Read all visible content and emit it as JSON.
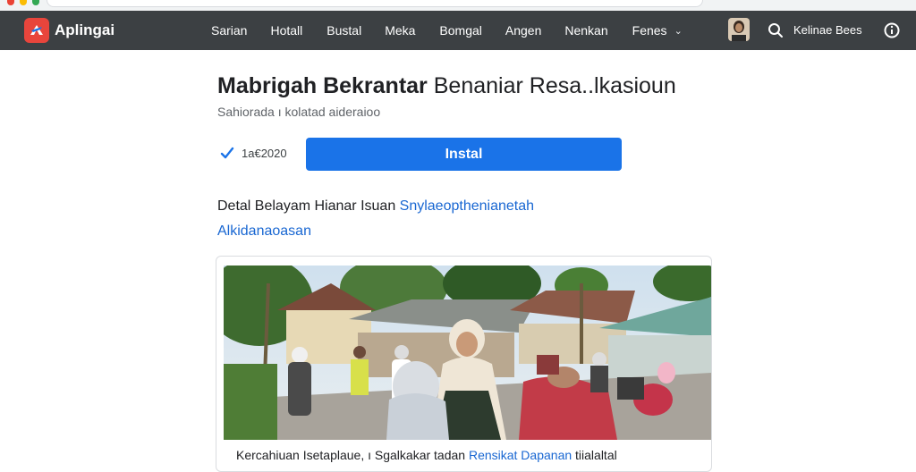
{
  "app": {
    "brand": "Aplingai"
  },
  "nav": {
    "items": [
      "Sarian",
      "Hotall",
      "Bustal",
      "Meka",
      "Bomgal",
      "Angen",
      "Nenkan",
      "Fenes"
    ]
  },
  "user": {
    "name": "Kelinae Bees"
  },
  "page": {
    "title_bold": "Mabrigah Bekrantar",
    "title_rest": " Benaniar Resa..lkasioun",
    "subtitle": "Sahiorada ı kolatad aideraioo",
    "date": "1a€2020",
    "install_label": "Instal",
    "detail_text": "Detal Belayam Hianar Isuan ",
    "detail_link": "Snylaeopthenianetah",
    "detail_link2": "Alkidanaoasan"
  },
  "card": {
    "caption_text": "Kercahiuan Isetaplaue, ı Sgalkakar tadan ",
    "caption_link": "Rensikat Dapanan",
    "caption_tail": " tiialaltal"
  },
  "icons": {
    "logo": "app-logo-icon",
    "search": "search-icon",
    "info": "info-icon",
    "check": "check-icon"
  },
  "colors": {
    "navbar": "#3c4043",
    "accent": "#1a73e8",
    "logo": "#e8453c",
    "link": "#1967d2"
  }
}
